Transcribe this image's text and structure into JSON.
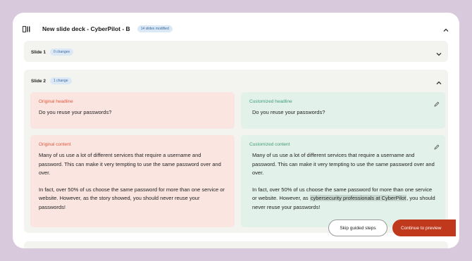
{
  "header": {
    "title": "New slide deck - CyberPilot - B",
    "badge": "14 slides modified"
  },
  "slides": [
    {
      "label": "Slide 1",
      "badge": "0 changes",
      "expanded": false
    },
    {
      "label": "Slide 2",
      "badge": "1 change",
      "expanded": true,
      "original_headline_label": "Original headline",
      "original_headline": "Do you reuse your passwords?",
      "customized_headline_label": "Customized headline",
      "customized_headline": "Do you reuse your passwords?",
      "original_content_label": "Original content",
      "original_content_p1": "Many of us use a lot of different services that require a username and password. This can make it very tempting to use the same password over and over.",
      "original_content_p2": "In fact, over 50% of us choose the same password for more than one service or website. However, as the story showed, you should never reuse your passwords!",
      "customized_content_label": "Customized content",
      "customized_content_p1": "Many of us use a lot of different services that require a username and password. This can make it very tempting to use the same password over and over.",
      "customized_content_p2_before": "In fact, over 50% of us choose the same password for more than one service or website. However, as ",
      "customized_content_p2_highlight": "cybersecurity professionals at CyberPilot",
      "customized_content_p2_after": ", you should never reuse your passwords!"
    }
  ],
  "buttons": {
    "skip": "Skip guided steps",
    "continue": "Continue to preview"
  },
  "icons": {
    "panel": "sidebar-panel-icon",
    "collapse": "chevron-up-icon",
    "expand": "chevron-down-icon",
    "edit": "pencil-icon"
  },
  "colors": {
    "accent": "#c0391d",
    "original_bg": "#fbe5e0",
    "customized_bg": "#e2f1ea",
    "badge_bg": "#dbe8f6"
  }
}
